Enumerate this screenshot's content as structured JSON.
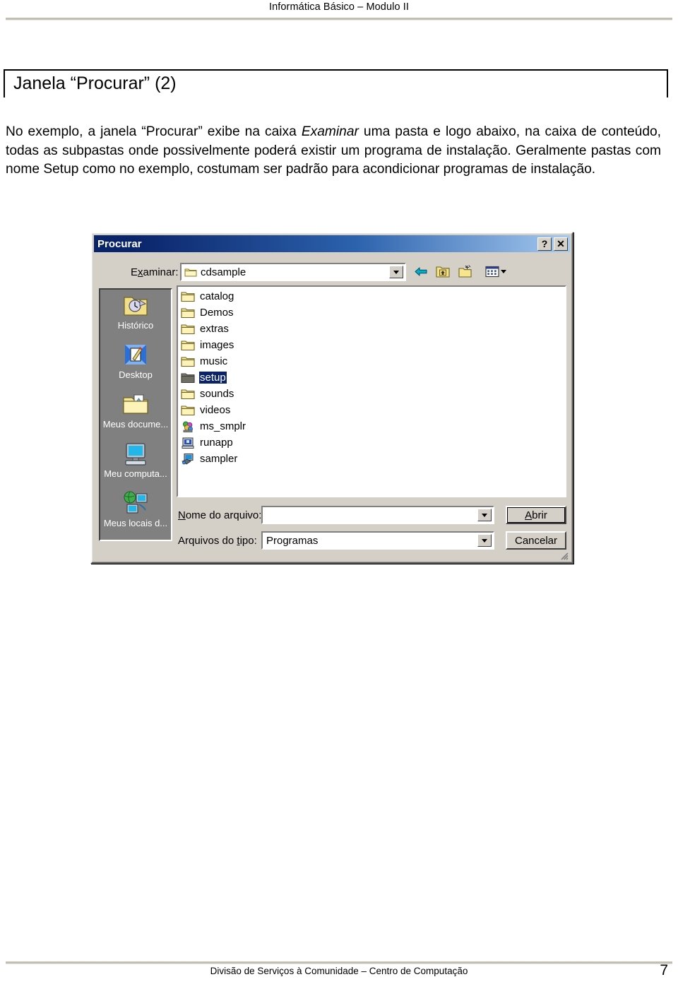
{
  "page_header": {
    "title": "Informática Básico – Modulo II"
  },
  "title_box": {
    "heading": "Janela “Procurar” (2)"
  },
  "body": {
    "part1": "No exemplo, a janela “Procurar” exibe na caixa ",
    "emphasis": "Examinar",
    "part2": " uma pasta e logo abaixo, na caixa de conteúdo, todas as subpastas onde possivelmente poderá existir um programa de instalação. Geralmente pastas com nome Setup como no exemplo, costumam ser padrão para acondicionar programas de instalação."
  },
  "dialog": {
    "title": "Procurar",
    "help_button": "?",
    "close_button": "✕",
    "look_in": {
      "label_pre": "E",
      "label_accel": "x",
      "label_post": "aminar:",
      "value": "cdsample"
    },
    "toolbar": [
      {
        "name": "back-icon",
        "tooltip": "Voltar"
      },
      {
        "name": "up-one-level-icon",
        "tooltip": "Um nível acima"
      },
      {
        "name": "new-folder-icon",
        "tooltip": "Criar nova pasta"
      },
      {
        "name": "views-icon",
        "tooltip": "Modos de exibição"
      }
    ],
    "places": [
      {
        "label": "Histórico",
        "icon": "history-folder-icon"
      },
      {
        "label": "Desktop",
        "icon": "desktop-icon"
      },
      {
        "label": "Meus docume...",
        "icon": "my-documents-icon"
      },
      {
        "label": "Meu computa...",
        "icon": "my-computer-icon"
      },
      {
        "label": "Meus locais d...",
        "icon": "my-network-places-icon"
      }
    ],
    "files": [
      {
        "name": "catalog",
        "type": "folder",
        "selected": false
      },
      {
        "name": "Demos",
        "type": "folder",
        "selected": false
      },
      {
        "name": "extras",
        "type": "folder",
        "selected": false
      },
      {
        "name": "images",
        "type": "folder",
        "selected": false
      },
      {
        "name": "music",
        "type": "folder",
        "selected": false
      },
      {
        "name": "setup",
        "type": "folder-open",
        "selected": true
      },
      {
        "name": "sounds",
        "type": "folder",
        "selected": false
      },
      {
        "name": "videos",
        "type": "folder",
        "selected": false
      },
      {
        "name": "ms_smplr",
        "type": "app-color",
        "selected": false
      },
      {
        "name": "runapp",
        "type": "app-window",
        "selected": false
      },
      {
        "name": "sampler",
        "type": "app-blue",
        "selected": false
      }
    ],
    "file_name_field": {
      "label_pre": "",
      "label_accel": "N",
      "label_post": "ome do arquivo:",
      "value": ""
    },
    "file_type_field": {
      "label_pre": "Arquivos do ",
      "label_accel": "t",
      "label_post": "ipo:",
      "value": "Programas"
    },
    "open_button": {
      "accel": "A",
      "rest": "brir"
    },
    "cancel_button": {
      "label": "Cancelar"
    }
  },
  "footer": {
    "text": "Divisão de Serviços à Comunidade – Centro de Computação",
    "page_number": "7"
  },
  "colors": {
    "titlebar_start": "#0a246a",
    "titlebar_end": "#a6caf0",
    "dialog_face": "#d4d0c8",
    "places_bar": "#808080",
    "selection": "#0a246a",
    "rule": "#c3bfb2"
  }
}
